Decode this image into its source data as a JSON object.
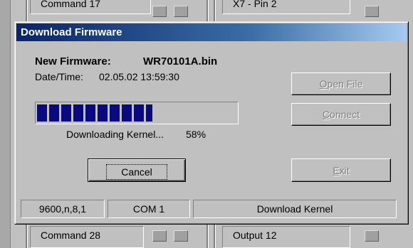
{
  "background": {
    "rows": [
      {
        "left_label": "Command 17",
        "right_label": "X7 - Pin 2"
      },
      {
        "left_label": "Command 28",
        "right_label": "Output 12"
      }
    ]
  },
  "dialog": {
    "title": "Download Firmware",
    "firmware_label": "New Firmware:",
    "firmware_name": "WR70101A.bin",
    "datetime_label": "Date/Time:",
    "datetime_value": "02.05.02 13:59:30",
    "progress_fraction": 0.58,
    "status_text": "Downloading Kernel...",
    "percent_text": "58%",
    "buttons": {
      "open_file": {
        "label": "Open File",
        "enabled": false
      },
      "connect": {
        "label": "Connect",
        "enabled": false
      },
      "cancel": {
        "label": "Cancel",
        "enabled": true
      },
      "exit": {
        "label": "Exit",
        "enabled": false
      }
    },
    "statusbar": {
      "baud": "9600,n,8,1",
      "port": "COM 1",
      "mode": "Download Kernel"
    }
  },
  "colors": {
    "title_gradient_start": "#0a246a",
    "title_gradient_end": "#a6caf0",
    "progress_fill": "#0a0a80",
    "face": "#c0c0c0"
  }
}
